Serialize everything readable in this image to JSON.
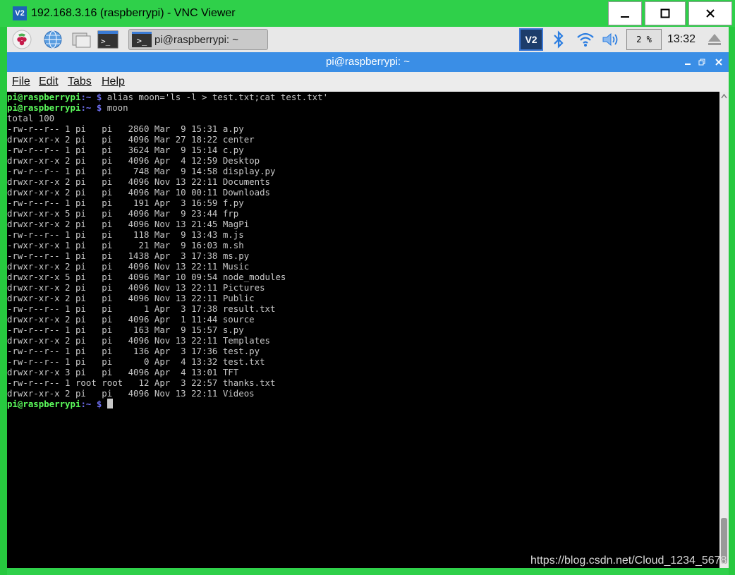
{
  "window": {
    "title": "192.168.3.16 (raspberrypi) - VNC Viewer",
    "logo_text": "V2",
    "controls": {
      "minimize": "—",
      "maximize": "☐",
      "close": "✕"
    }
  },
  "taskbar": {
    "task_label": "pi@raspberrypi: ~",
    "task_icon_text": ">_",
    "term_icon_text": ">_",
    "vnc_tray_text": "V2",
    "cpu_text": "2 %",
    "clock": "13:32"
  },
  "terminal": {
    "title": "pi@raspberrypi: ~",
    "menu": [
      "File",
      "Edit",
      "Tabs",
      "Help"
    ],
    "prompt_user": "pi@raspberrypi",
    "prompt_path": ":~ $",
    "commands": [
      "alias moon='ls -l > test.txt;cat test.txt'",
      "moon"
    ],
    "total": "total 100",
    "listing": [
      "-rw-r--r-- 1 pi   pi   2860 Mar  9 15:31 a.py",
      "drwxr-xr-x 2 pi   pi   4096 Mar 27 18:22 center",
      "-rw-r--r-- 1 pi   pi   3624 Mar  9 15:14 c.py",
      "drwxr-xr-x 2 pi   pi   4096 Apr  4 12:59 Desktop",
      "-rw-r--r-- 1 pi   pi    748 Mar  9 14:58 display.py",
      "drwxr-xr-x 2 pi   pi   4096 Nov 13 22:11 Documents",
      "drwxr-xr-x 2 pi   pi   4096 Mar 10 00:11 Downloads",
      "-rw-r--r-- 1 pi   pi    191 Apr  3 16:59 f.py",
      "drwxr-xr-x 5 pi   pi   4096 Mar  9 23:44 frp",
      "drwxr-xr-x 2 pi   pi   4096 Nov 13 21:45 MagPi",
      "-rw-r--r-- 1 pi   pi    118 Mar  9 13:43 m.js",
      "-rwxr-xr-x 1 pi   pi     21 Mar  9 16:03 m.sh",
      "-rw-r--r-- 1 pi   pi   1438 Apr  3 17:38 ms.py",
      "drwxr-xr-x 2 pi   pi   4096 Nov 13 22:11 Music",
      "drwxr-xr-x 5 pi   pi   4096 Mar 10 09:54 node_modules",
      "drwxr-xr-x 2 pi   pi   4096 Nov 13 22:11 Pictures",
      "drwxr-xr-x 2 pi   pi   4096 Nov 13 22:11 Public",
      "-rw-r--r-- 1 pi   pi      1 Apr  3 17:38 result.txt",
      "drwxr-xr-x 2 pi   pi   4096 Apr  1 11:44 source",
      "-rw-r--r-- 1 pi   pi    163 Mar  9 15:57 s.py",
      "drwxr-xr-x 2 pi   pi   4096 Nov 13 22:11 Templates",
      "-rw-r--r-- 1 pi   pi    136 Apr  3 17:36 test.py",
      "-rw-r--r-- 1 pi   pi      0 Apr  4 13:32 test.txt",
      "drwxr-xr-x 3 pi   pi   4096 Apr  4 13:01 TFT",
      "-rw-r--r-- 1 root root   12 Apr  3 22:57 thanks.txt",
      "drwxr-xr-x 2 pi   pi   4096 Nov 13 22:11 Videos"
    ]
  },
  "watermark": "https://blog.csdn.net/Cloud_1234_5678",
  "colors": {
    "titlebar": "#2fd04a",
    "terminal_title": "#3a8ee6",
    "prompt_user": "#5cfc5c",
    "prompt_path": "#6f6ff2"
  }
}
